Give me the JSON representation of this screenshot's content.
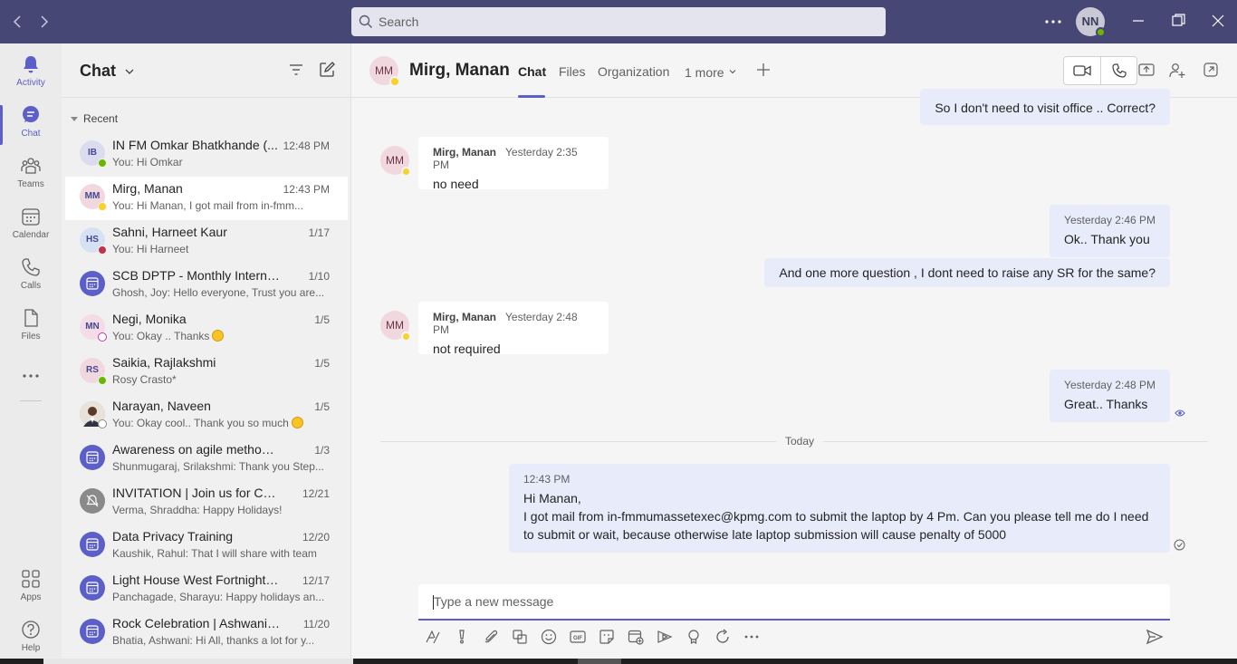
{
  "search": {
    "placeholder": "Search"
  },
  "user": {
    "initials": "NN"
  },
  "rail": [
    {
      "label": "Activity",
      "icon": "bell-icon"
    },
    {
      "label": "Chat",
      "icon": "chat-icon",
      "active": true
    },
    {
      "label": "Teams",
      "icon": "teams-icon"
    },
    {
      "label": "Calendar",
      "icon": "calendar-icon"
    },
    {
      "label": "Calls",
      "icon": "phone-icon"
    },
    {
      "label": "Files",
      "icon": "file-icon"
    },
    {
      "label": "Apps",
      "icon": "apps-icon"
    },
    {
      "label": "Help",
      "icon": "help-icon"
    }
  ],
  "chatlist": {
    "title": "Chat",
    "section": "Recent",
    "rows": [
      {
        "initials": "IB",
        "name": "IN FM Omkar Bhatkhande (...",
        "time": "12:48 PM",
        "preview": "You: Hi Omkar",
        "avatar_bg": "#dcdcf0",
        "presence": "#6bb700"
      },
      {
        "initials": "MM",
        "name": "Mirg, Manan",
        "time": "12:43 PM",
        "preview": "You: Hi Manan, I got mail from in-fmm...",
        "avatar_bg": "#f1d8de",
        "presence": "#f8d22a",
        "selected": true
      },
      {
        "initials": "HS",
        "name": "Sahni, Harneet Kaur",
        "time": "1/17",
        "preview": "You: Hi Harneet",
        "avatar_bg": "#d6e2f3",
        "presence": "#c4314b"
      },
      {
        "initials": "",
        "name": "SCB DPTP - Monthly Internal Hu...",
        "time": "1/10",
        "preview": "Ghosh, Joy: Hello everyone, Trust you are...",
        "avatar_bg": "#5b5fc7",
        "meeting": true
      },
      {
        "initials": "MN",
        "name": "Negi, Monika",
        "time": "1/5",
        "preview": "You: Okay .. Thanks",
        "avatar_bg": "#f4dbe6",
        "presence": "#ffffff",
        "emoji": true
      },
      {
        "initials": "RS",
        "name": "Saikia, Rajlakshmi",
        "time": "1/5",
        "preview": "Rosy Crasto*",
        "avatar_bg": "#f1d8de",
        "presence": "#6bb700"
      },
      {
        "initials": "",
        "name": "Narayan, Naveen",
        "time": "1/5",
        "preview": "You: Okay cool.. Thank you so much",
        "avatar_bg": "#bfae9c",
        "photo": true,
        "emoji": true
      },
      {
        "initials": "",
        "name": "Awareness on agile methodologi...",
        "time": "1/3",
        "preview": "Shunmugaraj, Srilakshmi: Thank you Step...",
        "avatar_bg": "#5b5fc7",
        "meeting": true
      },
      {
        "initials": "",
        "name": "INVITATION | Join us for Christ...",
        "time": "12/21",
        "preview": "Verma, Shraddha: Happy Holidays!",
        "avatar_bg": "#8a8a8a",
        "muted": true
      },
      {
        "initials": "",
        "name": "Data Privacy Training",
        "time": "12/20",
        "preview": "Kaushik, Rahul: That I will share with team",
        "avatar_bg": "#5b5fc7",
        "meeting": true
      },
      {
        "initials": "",
        "name": "Light House West Fortnightly c...",
        "time": "12/17",
        "preview": "Panchagade, Sharayu: Happy holidays an...",
        "avatar_bg": "#5b5fc7",
        "meeting": true
      },
      {
        "initials": "",
        "name": "Rock Celebration | Ashwani Bha...",
        "time": "11/20",
        "preview": "Bhatia, Ashwani: Hi All, thanks a lot for y...",
        "avatar_bg": "#5b5fc7",
        "meeting": true
      }
    ]
  },
  "conversation": {
    "initials": "MM",
    "name": "Mirg, Manan",
    "tabs": [
      "Chat",
      "Files",
      "Organization",
      "1 more"
    ],
    "messages": {
      "m0_body": "So I don't need to visit office .. Correct?",
      "m1_author": "Mirg, Manan",
      "m1_time": "Yesterday 2:35 PM",
      "m1_body": "no need",
      "m2_time": "Yesterday 2:46 PM",
      "m2_body": "Ok.. Thank you",
      "m3_body": "And one more question , I dont need to raise any SR for the same?",
      "m4_author": "Mirg, Manan",
      "m4_time": "Yesterday 2:48 PM",
      "m4_body": "not required",
      "m5_time": "Yesterday 2:48 PM",
      "m5_body": "Great.. Thanks",
      "divider": "Today",
      "m6_time": "12:43 PM",
      "m6_line1": "Hi Manan,",
      "m6_line2": "I got mail from in-fmmumassetexec@kpmg.com to submit the laptop by 4 Pm. Can you please tell me do I need to submit or wait, because otherwise late laptop submission will cause penalty of 5000"
    }
  },
  "compose": {
    "placeholder": "Type a new message"
  },
  "toolbar": [
    "format-icon",
    "important-icon",
    "attach-icon",
    "loop-icon",
    "emoji-icon",
    "gif-icon",
    "sticker-icon",
    "schedule-meeting-icon",
    "stream-icon",
    "praise-icon",
    "refresh-icon",
    "more-icon"
  ],
  "colors": {
    "accent": "#5b5fc7",
    "titlebar": "#464775",
    "outgoing_bubble": "#e8ebfa"
  }
}
